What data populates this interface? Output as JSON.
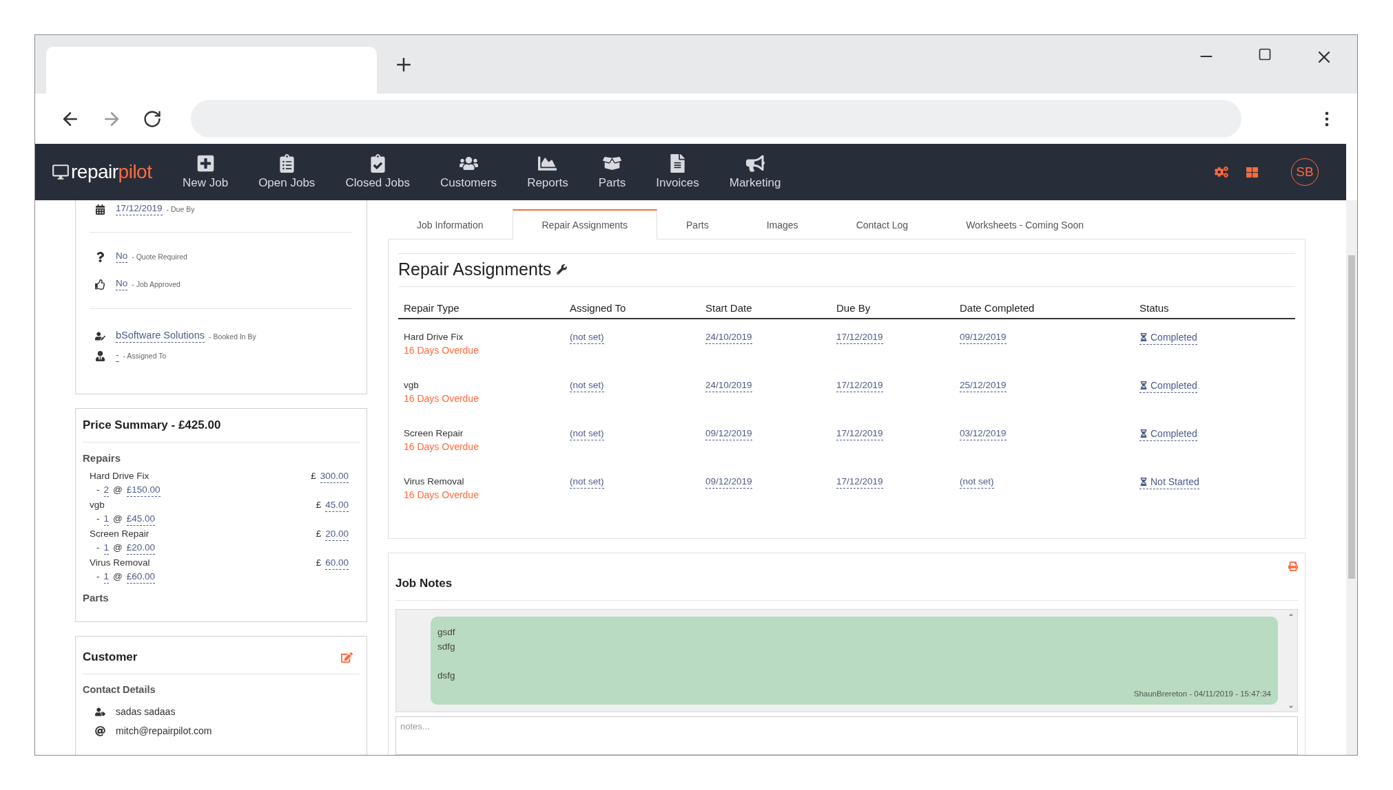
{
  "app": {
    "logo": {
      "first": "repair",
      "second": "pilot"
    },
    "nav_items": [
      {
        "label": "New Job"
      },
      {
        "label": "Open Jobs"
      },
      {
        "label": "Closed Jobs"
      },
      {
        "label": "Customers"
      },
      {
        "label": "Reports"
      },
      {
        "label": "Parts"
      },
      {
        "label": "Invoices"
      },
      {
        "label": "Marketing"
      }
    ],
    "user_initials": "SB"
  },
  "job_details": {
    "rows": [
      {
        "kind": "due",
        "value": "17/12/2019",
        "label": "- Due By"
      },
      {
        "kind": "quote",
        "value": "No",
        "label": "- Quote Required"
      },
      {
        "kind": "approved",
        "value": "No",
        "label": "- Job Approved"
      },
      {
        "kind": "booked",
        "value": "bSoftware Solutions",
        "label": "- Booked In By"
      },
      {
        "kind": "assigned",
        "value": "-",
        "label": "- Assigned To"
      }
    ]
  },
  "price_summary": {
    "title": "Price Summary - £425.00",
    "repairs_heading": "Repairs",
    "currency": "£",
    "qty_prefix": "-",
    "unit_separator": "@",
    "items": [
      {
        "name": "Hard Drive Fix",
        "amount": "300.00",
        "qty": "2",
        "unit_price": "£150.00"
      },
      {
        "name": "vgb",
        "amount": "45.00",
        "qty": "1",
        "unit_price": "£45.00"
      },
      {
        "name": "Screen Repair",
        "amount": "20.00",
        "qty": "1",
        "unit_price": "£20.00"
      },
      {
        "name": "Virus Removal",
        "amount": "60.00",
        "qty": "1",
        "unit_price": "£60.00"
      }
    ],
    "parts_heading": "Parts"
  },
  "customer": {
    "title": "Customer",
    "heading": "Contact Details",
    "contacts": [
      {
        "kind": "name",
        "text": "sadas sadaas"
      },
      {
        "kind": "email",
        "text": "mitch@repairpilot.com"
      }
    ]
  },
  "tabs": [
    {
      "label": "Job Information",
      "selected": false
    },
    {
      "label": "Repair Assignments",
      "selected": true
    },
    {
      "label": "Parts",
      "selected": false
    },
    {
      "label": "Images",
      "selected": false
    },
    {
      "label": "Contact Log",
      "selected": false
    },
    {
      "label": "Worksheets - Coming Soon",
      "selected": false
    }
  ],
  "repair_assignments": {
    "title": "Repair Assignments",
    "columns": [
      "Repair Type",
      "Assigned To",
      "Start Date",
      "Due By",
      "Date Completed",
      "Status"
    ],
    "rows": [
      {
        "repair_type": "Hard Drive Fix",
        "overdue": "16 Days Overdue",
        "assigned_to": "(not set)",
        "start_date": "24/10/2019",
        "due_by": "17/12/2019",
        "date_completed": "09/12/2019",
        "status": "Completed"
      },
      {
        "repair_type": "vgb",
        "overdue": "16 Days Overdue",
        "assigned_to": "(not set)",
        "start_date": "24/10/2019",
        "due_by": "17/12/2019",
        "date_completed": "25/12/2019",
        "status": "Completed"
      },
      {
        "repair_type": "Screen Repair",
        "overdue": "16 Days Overdue",
        "assigned_to": "(not set)",
        "start_date": "09/12/2019",
        "due_by": "17/12/2019",
        "date_completed": "03/12/2019",
        "status": "Completed"
      },
      {
        "repair_type": "Virus Removal",
        "overdue": "16 Days Overdue",
        "assigned_to": "(not set)",
        "start_date": "09/12/2019",
        "due_by": "17/12/2019",
        "date_completed": "(not set)",
        "status": "Not Started"
      }
    ]
  },
  "job_notes": {
    "title": "Job Notes",
    "notes": [
      {
        "text": "gsdf\nsdfg\n\ndsfg",
        "footer": "ShaunBrereton - 04/11/2019 - 15:47:34"
      }
    ],
    "placeholder": "notes..."
  }
}
